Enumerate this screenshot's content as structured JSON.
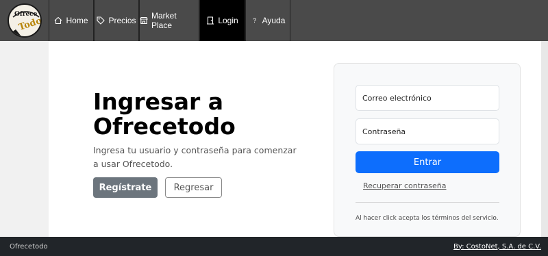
{
  "brand": {
    "logo_text": "Ofrece Todo"
  },
  "nav": {
    "items": [
      {
        "label": "Home",
        "icon": "home-icon"
      },
      {
        "label": "Precios",
        "icon": "price-tag-icon"
      },
      {
        "label": "Market Place",
        "icon": "store-icon"
      },
      {
        "label": "Login",
        "icon": "door-icon"
      },
      {
        "label": "Ayuda",
        "icon": "question-icon"
      }
    ],
    "active": "Login"
  },
  "hero": {
    "title": "Ingresar a Ofrecetodo",
    "subtitle": "Ingresa tu usuario y contraseña para comenzar a usar Ofrecetodo.",
    "register_label": "Regístrate",
    "back_label": "Regresar"
  },
  "login": {
    "email_placeholder": "Correo electrónico",
    "password_placeholder": "Contraseña",
    "submit_label": "Entrar",
    "recover_label": "Recuperar contraseña",
    "terms_text": "Al hacer click acepta los términos del servicio."
  },
  "footer": {
    "left": "Ofrecetodo",
    "right": "By: CostoNet, S.A. de C.V."
  },
  "colors": {
    "navbar": "#4a4a4a",
    "nav_active": "#000000",
    "primary": "#0d6efd",
    "secondary": "#6c757d",
    "footer": "#212529"
  }
}
